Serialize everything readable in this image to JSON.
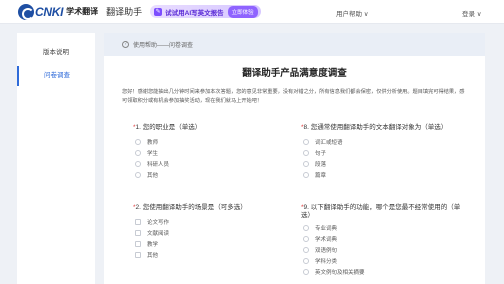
{
  "header": {
    "logo_text": "CNKI",
    "logo_sub": "学术翻译",
    "app_title": "翻译助手",
    "promo_text": "试试用AI写英文报告",
    "promo_button": "立即体验",
    "user_help": "用户帮助 ∨",
    "login": "登录 ∨"
  },
  "sidebar": {
    "items": [
      {
        "label": "版本说明"
      },
      {
        "label": "问卷调查"
      }
    ]
  },
  "breadcrumb": "使用帮助——问卷调查",
  "page_title": "翻译助手产品满意度调查",
  "intro": "您好！感谢您能抽出几分钟时间来参加本次答题，您的意见非常重要，没有对错之分，所有信息我们都会保密，仅供分析使用。题目填完可得结果，感可领取积分或有机会参加抽奖活动，现在我们就马上开始吧！",
  "questions": [
    {
      "title": "1. 您的职业是（单选）",
      "type": "radio",
      "options": [
        "教师",
        "学生",
        "科研人员",
        "其他"
      ]
    },
    {
      "title": "8. 您通常使用翻译助手的文本翻译对象为（单选）",
      "type": "radio",
      "options": [
        "词汇或短语",
        "句子",
        "段落",
        "篇章"
      ]
    },
    {
      "title": "2. 您使用翻译助手的场景是（可多选）",
      "type": "checkbox",
      "options": [
        "论文写作",
        "文献阅读",
        "教学",
        "其他"
      ]
    },
    {
      "title": "9. 以下翻译助手的功能，哪个是您最不经常使用的（单选）",
      "type": "radio",
      "options": [
        "专业词典",
        "学术词典",
        "双语例句",
        "学科分类",
        "英文例句及相关摘要"
      ]
    }
  ]
}
